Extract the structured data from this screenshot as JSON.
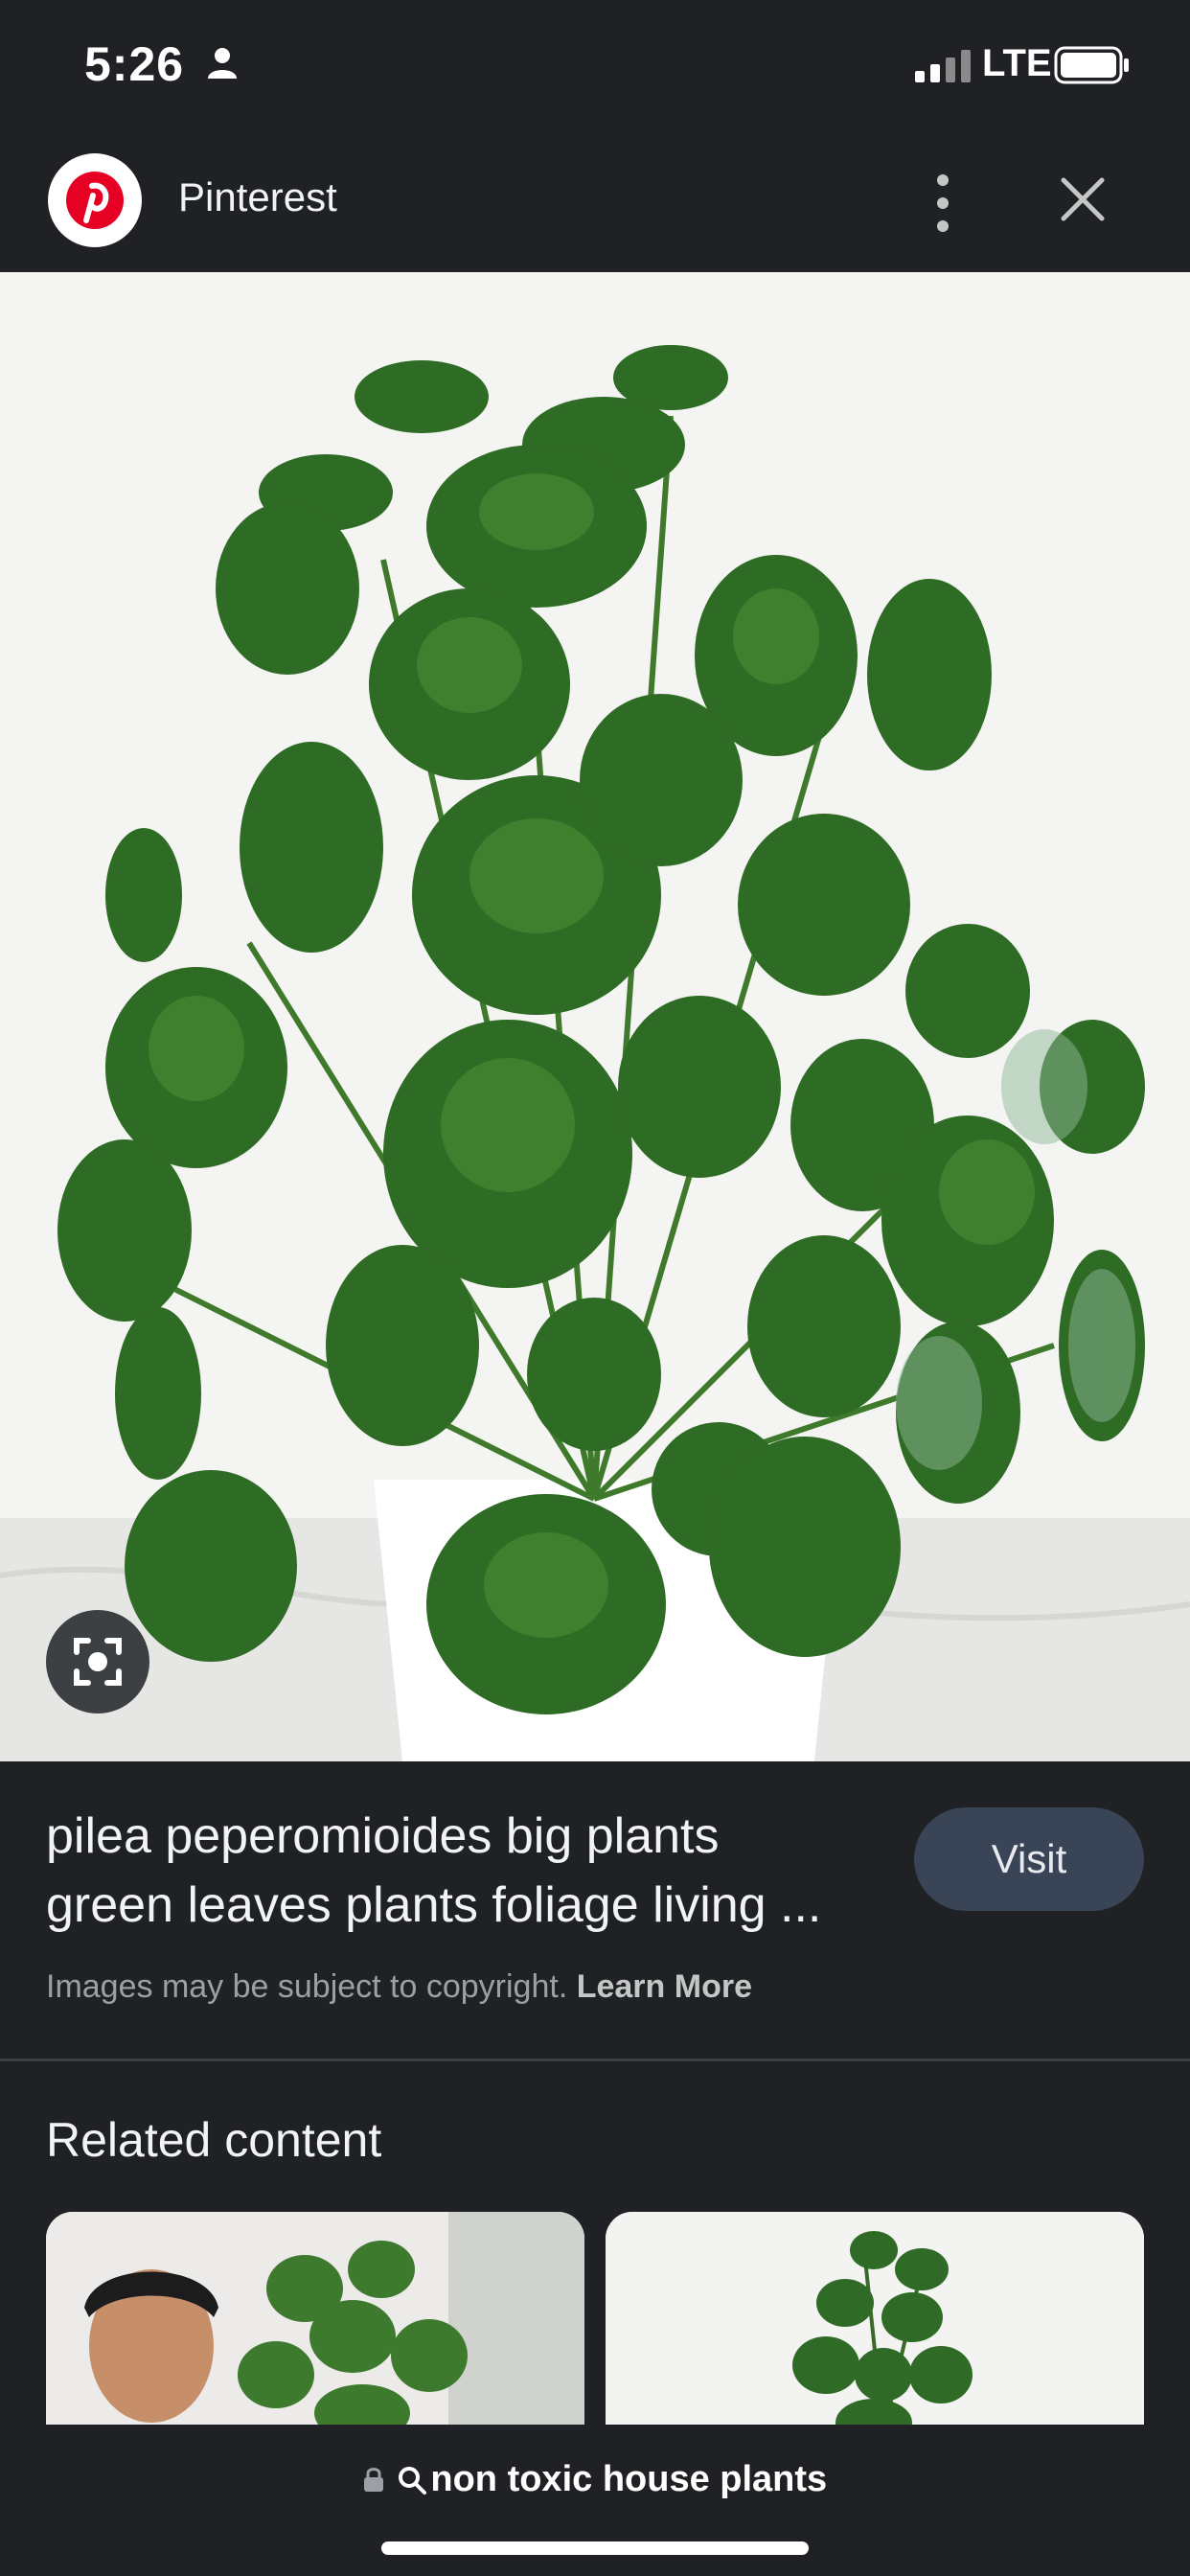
{
  "status": {
    "time": "5:26",
    "network": "LTE"
  },
  "header": {
    "site_name": "Pinterest"
  },
  "result": {
    "caption_line1": "pilea peperomioides big plants",
    "caption_line2": "green leaves plants foliage living ...",
    "visit_label": "Visit",
    "copyright_text": "Images may be subject to copyright. ",
    "learn_more": "Learn More"
  },
  "related": {
    "title": "Related content"
  },
  "search": {
    "query": "non toxic house plants"
  },
  "colors": {
    "background": "#202124",
    "visit_button": "#394457",
    "pinterest_red": "#e60023"
  },
  "icons": [
    "person-icon",
    "signal-icon",
    "battery-icon",
    "pinterest-logo-icon",
    "more-vert-icon",
    "close-icon",
    "lens-icon",
    "lock-icon",
    "search-icon"
  ]
}
